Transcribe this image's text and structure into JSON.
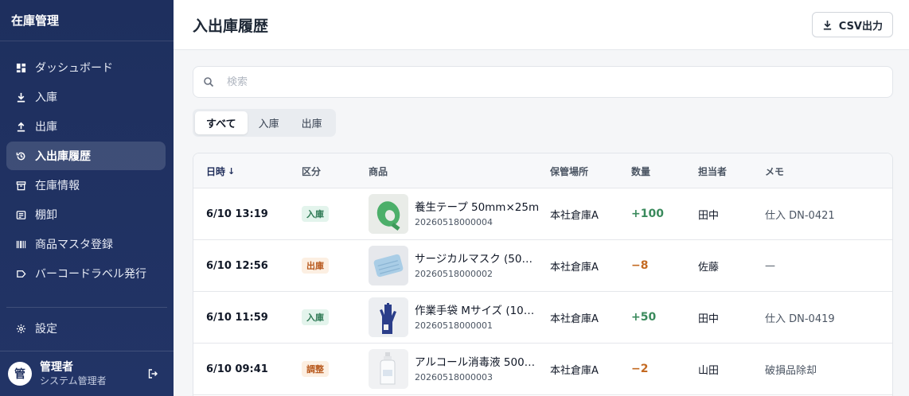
{
  "app_title": "在庫管理",
  "sidebar": {
    "items": [
      {
        "label": "ダッシュボード",
        "icon": "dashboard-icon"
      },
      {
        "label": "入庫",
        "icon": "download-icon"
      },
      {
        "label": "出庫",
        "icon": "upload-icon"
      },
      {
        "label": "入出庫履歴",
        "icon": "history-icon",
        "active": true
      },
      {
        "label": "在庫情報",
        "icon": "inventory-icon"
      },
      {
        "label": "棚卸",
        "icon": "stocktake-icon"
      },
      {
        "label": "商品マスタ登録",
        "icon": "barcode-icon"
      },
      {
        "label": "バーコードラベル発行",
        "icon": "label-icon"
      }
    ],
    "settings_label": "設定",
    "user": {
      "avatar": "管",
      "name": "管理者",
      "role": "システム管理者"
    }
  },
  "header": {
    "title": "入出庫履歴",
    "csv_label": "CSV出力"
  },
  "search": {
    "placeholder": "検索"
  },
  "tabs": [
    "すべて",
    "入庫",
    "出庫"
  ],
  "table": {
    "columns": {
      "date": "日時",
      "type": "区分",
      "product": "商品",
      "location": "保管場所",
      "qty": "数量",
      "staff": "担当者",
      "memo": "メモ"
    },
    "rows": [
      {
        "date": "6/10 13:19",
        "type": "入庫",
        "name": "養生テープ 50mm×25m",
        "code": "20260518000004",
        "location": "本社倉庫A",
        "qty": "+100",
        "staff": "田中",
        "memo": "仕入 DN-0421"
      },
      {
        "date": "6/10 12:56",
        "type": "出庫",
        "name": "サージカルマスク (50…",
        "code": "20260518000002",
        "location": "本社倉庫A",
        "qty": "−8",
        "staff": "佐藤",
        "memo": "—"
      },
      {
        "date": "6/10 11:59",
        "type": "入庫",
        "name": "作業手袋 Mサイズ (10…",
        "code": "20260518000001",
        "location": "本社倉庫A",
        "qty": "+50",
        "staff": "田中",
        "memo": "仕入 DN-0419"
      },
      {
        "date": "6/10 09:41",
        "type": "調整",
        "name": "アルコール消毒液 500…",
        "code": "20260518000003",
        "location": "本社倉庫A",
        "qty": "−2",
        "staff": "山田",
        "memo": "破損品除却"
      }
    ]
  },
  "colors": {
    "sidebar_bg": "#1e2f5e",
    "positive": "#3a8a5c",
    "negative": "#c46a22",
    "badge_in_bg": "#e3f4ec",
    "badge_out_bg": "#fcefe2"
  }
}
